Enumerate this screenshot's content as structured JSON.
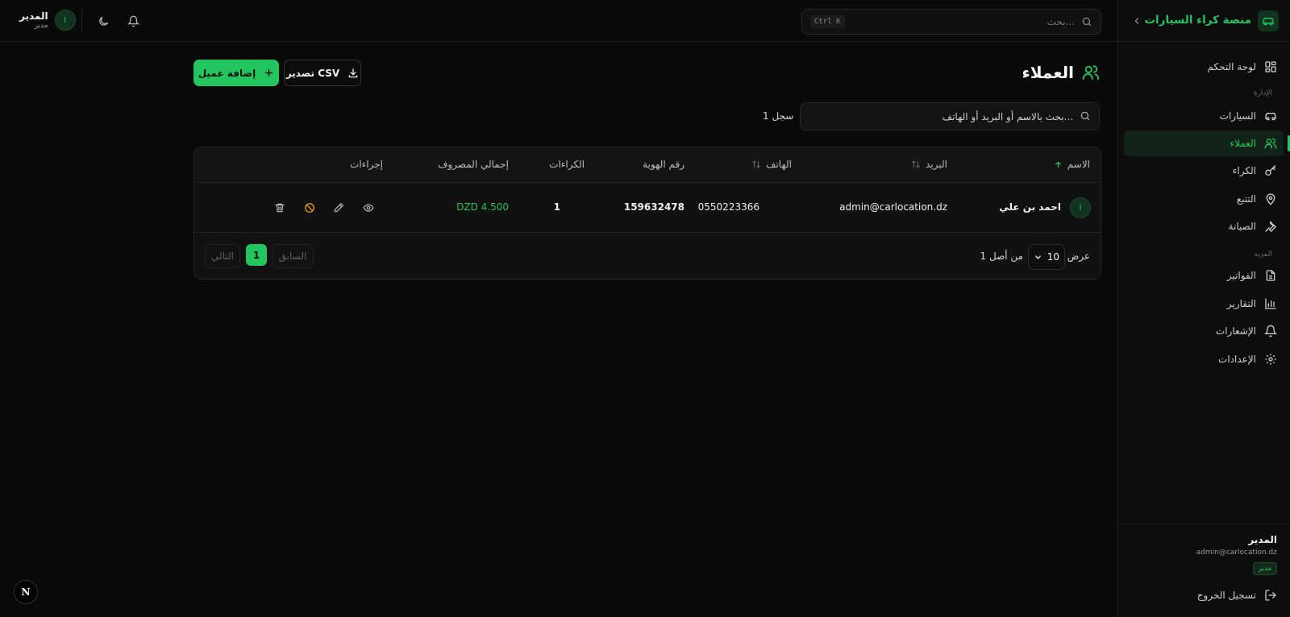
{
  "app": {
    "brand": "منصة كراء السيارات"
  },
  "topbar": {
    "search_placeholder": "بحث...",
    "shortcut": "Ctrl K",
    "user_name": "المدير",
    "user_role": "مدير",
    "avatar_initial": "I"
  },
  "sidebar": {
    "dashboard": "لوحة التحكم",
    "section_management": "الإدارة",
    "cars": "السيارات",
    "clients": "العملاء",
    "rentals": "الكراء",
    "tracking": "التتبع",
    "maintenance": "الصيانة",
    "section_more": "المزيد",
    "invoices": "الفواتير",
    "reports": "التقارير",
    "notifications": "الإشعارات",
    "settings": "الإعدادات",
    "footer_name": "المدير",
    "footer_email": "admin@carlocation.dz",
    "footer_role": "مدير",
    "logout": "تسجيل الخروج"
  },
  "page": {
    "title": "العملاء",
    "export_label": "تصدير CSV",
    "add_label": "إضافة عميل",
    "search_placeholder": "بحث بالاسم أو البريد أو الهاتف...",
    "record_count": "1 سجل"
  },
  "table": {
    "columns": {
      "name": "الاسم",
      "email": "البريد",
      "phone": "الهاتف",
      "id_number": "رقم الهوية",
      "rentals": "الكراءات",
      "total_spent": "إجمالي المصروف",
      "actions": "إجراءات"
    },
    "rows": [
      {
        "initial": "I",
        "name": "احمد بن علي",
        "email": "admin@carlocation.dz",
        "phone": "0550223366",
        "id_number": "159632478",
        "rentals": "1",
        "total_spent": "DZD 4.500"
      }
    ],
    "footer": {
      "show_label": "عرض",
      "page_size": "10",
      "of_label": "من أصل 1",
      "prev": "السابق",
      "current_page": "1",
      "next": "التالي"
    }
  },
  "colors": {
    "accent": "#22c55e",
    "warning": "#f59e0b",
    "background": "#0a0a0a"
  },
  "badge_logo": "N"
}
